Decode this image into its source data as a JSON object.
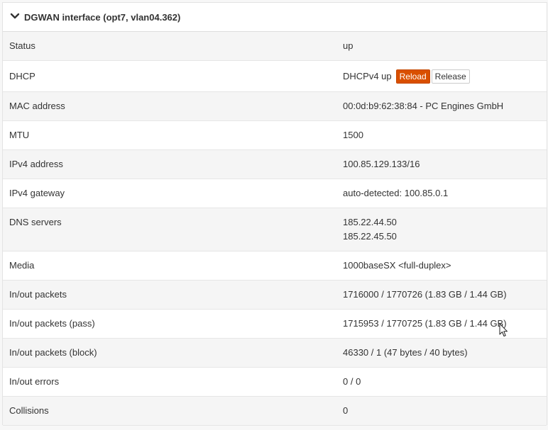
{
  "panel": {
    "title": "DGWAN interface (opt7, vlan04.362)",
    "icon": "chevron-down-icon"
  },
  "rows": [
    {
      "label": "Status",
      "value": "up"
    },
    {
      "label": "DHCP",
      "value": "DHCPv4 up",
      "buttons": {
        "reload": "Reload",
        "release": "Release"
      }
    },
    {
      "label": "MAC address",
      "value": "00:0d:b9:62:38:84 - PC Engines GmbH"
    },
    {
      "label": "MTU",
      "value": "1500"
    },
    {
      "label": "IPv4 address",
      "value": "100.85.129.133/16"
    },
    {
      "label": "IPv4 gateway",
      "value": "auto-detected: 100.85.0.1"
    },
    {
      "label": "DNS servers",
      "values": [
        "185.22.44.50",
        "185.22.45.50"
      ]
    },
    {
      "label": "Media",
      "value": "1000baseSX <full-duplex>"
    },
    {
      "label": "In/out packets",
      "value": "1716000 / 1770726 (1.83 GB / 1.44 GB)"
    },
    {
      "label": "In/out packets (pass)",
      "value": "1715953 / 1770725 (1.83 GB / 1.44 GB)"
    },
    {
      "label": "In/out packets (block)",
      "value": "46330 / 1 (47 bytes / 40 bytes)"
    },
    {
      "label": "In/out errors",
      "value": "0 / 0"
    },
    {
      "label": "Collisions",
      "value": "0"
    }
  ],
  "colors": {
    "reload_button": "#d94f00",
    "row_alt": "#f5f5f5"
  }
}
